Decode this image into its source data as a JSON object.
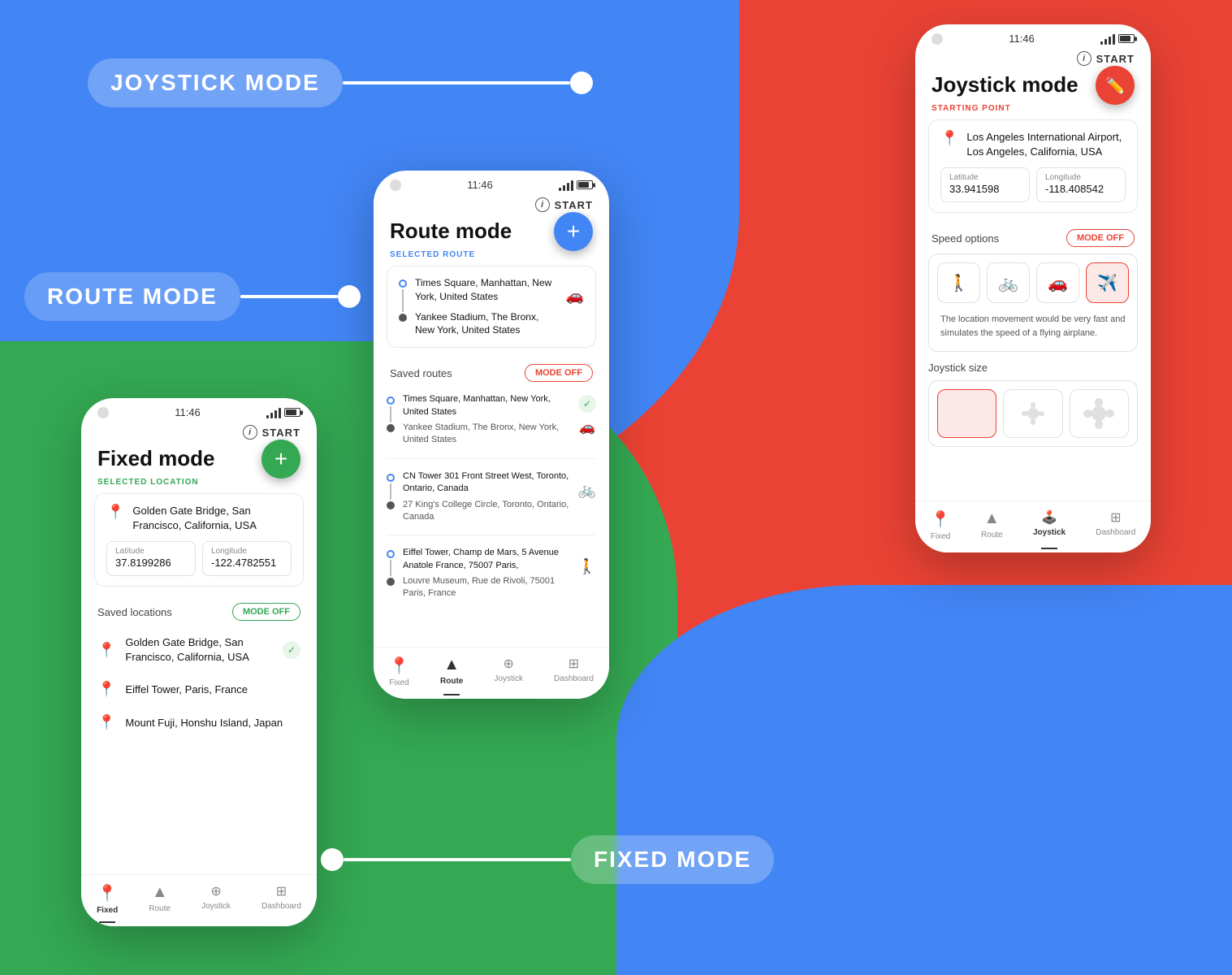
{
  "background": {
    "blue": "#4285F4",
    "red": "#EA4335",
    "green": "#34A853"
  },
  "modes": {
    "joystick": {
      "label": "JOYSTICK MODE"
    },
    "route": {
      "label": "ROUTE MODE"
    },
    "fixed": {
      "label": "FIXED MODE"
    }
  },
  "phone_route": {
    "status_time": "11:46",
    "start_btn": "START",
    "title": "Route mode",
    "selected_route_label": "SELECTED ROUTE",
    "from": "Times Square, Manhattan, New York, United States",
    "to": "Yankee Stadium, The Bronx, New York, United States",
    "saved_routes_label": "Saved routes",
    "mode_off": "MODE OFF",
    "fab": "+",
    "routes": [
      {
        "from": "Times Square, Manhattan, New York, United States",
        "to": "Yankee Stadium, The Bronx, New York, United States",
        "icon": "car"
      },
      {
        "from": "CN Tower 301 Front Street West, Toronto, Ontario, Canada",
        "to": "27 King's College Circle, Toronto, Ontario, Canada",
        "icon": "bike"
      },
      {
        "from": "Eiffel Tower, Champ de Mars, 5 Avenue Anatole France, 75007 Paris,",
        "to": "Louvre Museum, Rue de Rivoli, 75001 Paris, France",
        "icon": "walk"
      }
    ],
    "nav_items": [
      "Fixed",
      "Route",
      "Joystick",
      "Dashboard"
    ],
    "nav_active": "Route"
  },
  "phone_fixed": {
    "status_time": "11:46",
    "start_btn": "START",
    "title": "Fixed mode",
    "selected_location_label": "SELECTED LOCATION",
    "location": "Golden Gate Bridge, San Francisco, California, USA",
    "latitude_label": "Latitude",
    "latitude": "37.8199286",
    "longitude_label": "Longitude",
    "longitude": "-122.4782551",
    "saved_locations_label": "Saved locations",
    "mode_off": "MODE OFF",
    "fab": "+",
    "saved": [
      {
        "name": "Golden Gate Bridge, San Francisco, California, USA",
        "active": true
      },
      {
        "name": "Eiffel Tower, Paris, France",
        "active": false
      },
      {
        "name": "Mount Fuji, Honshu Island, Japan",
        "active": false
      }
    ],
    "nav_items": [
      "Fixed",
      "Route",
      "Joystick",
      "Dashboard"
    ],
    "nav_active": "Fixed"
  },
  "phone_joystick": {
    "status_time": "11:46",
    "start_btn": "START",
    "title": "Joystick mode",
    "starting_point_label": "STARTING POINT",
    "location": "Los Angeles International Airport, Los Angeles, California, USA",
    "latitude_label": "Latitude",
    "latitude": "33.941598",
    "longitude_label": "Longitude",
    "longitude": "-118.408542",
    "speed_options_label": "Speed options",
    "mode_off": "MODE OFF",
    "speed_desc": "The location movement would be very fast and simulates the speed of a flying airplane.",
    "joystick_size_label": "Joystick size",
    "nav_items": [
      "Fixed",
      "Route",
      "Joystick",
      "Dashboard"
    ],
    "nav_active": "Joystick"
  }
}
